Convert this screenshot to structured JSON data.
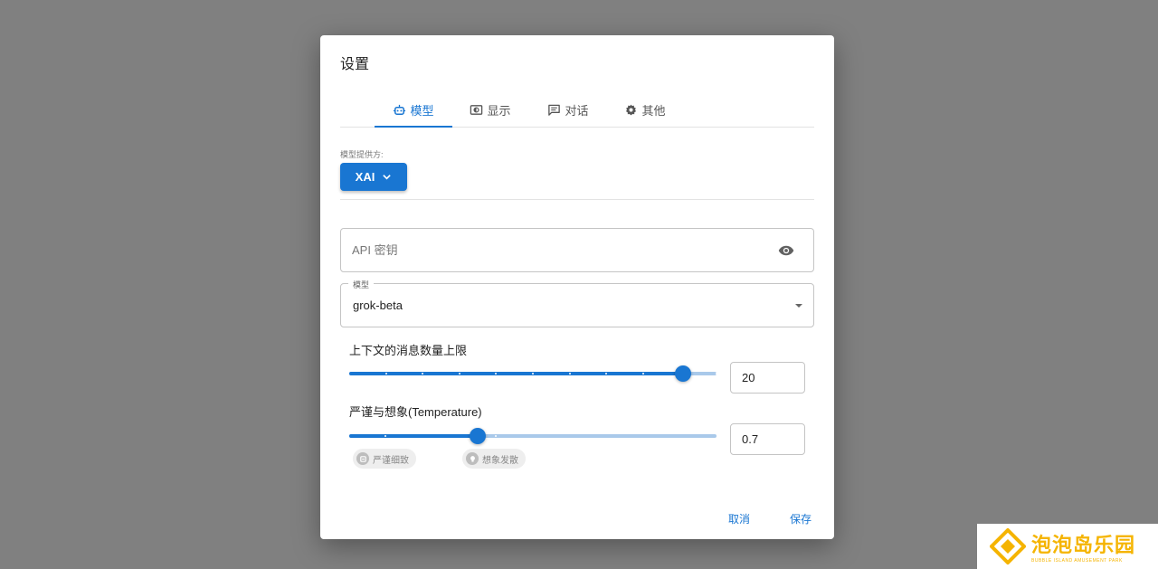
{
  "dialog": {
    "title": "设置",
    "tabs": [
      {
        "label": "模型",
        "icon": "robot-icon",
        "active": true
      },
      {
        "label": "显示",
        "icon": "display-icon",
        "active": false
      },
      {
        "label": "对话",
        "icon": "chat-icon",
        "active": false
      },
      {
        "label": "其他",
        "icon": "gear-icon",
        "active": false
      }
    ],
    "provider": {
      "label": "模型提供方:",
      "value": "XAI",
      "icon": "chevron-down-icon"
    },
    "api_key": {
      "placeholder": "API 密钥",
      "value": "",
      "icon": "eye-icon"
    },
    "model": {
      "label": "模型",
      "value": "grok-beta",
      "icon": "dropdown-arrow-icon"
    },
    "context_limit": {
      "label": "上下文的消息数量上限",
      "value": "20",
      "fraction": 0.91,
      "marks": 11
    },
    "temperature": {
      "label": "严谨与想象(Temperature)",
      "value": "0.7",
      "fraction": 0.35
    },
    "chips": [
      {
        "label": "严谨细致",
        "icon": "rigor-icon"
      },
      {
        "label": "想象发散",
        "icon": "lightbulb-icon"
      }
    ],
    "actions": {
      "cancel": "取消",
      "save": "保存"
    }
  },
  "watermark": {
    "main": "泡泡岛乐园",
    "sub": "BUBBLE ISLAND AMUSEMENT PARK"
  },
  "colors": {
    "accent": "#1976d2",
    "overlay": "#808080",
    "watermark": "#f5b400"
  }
}
